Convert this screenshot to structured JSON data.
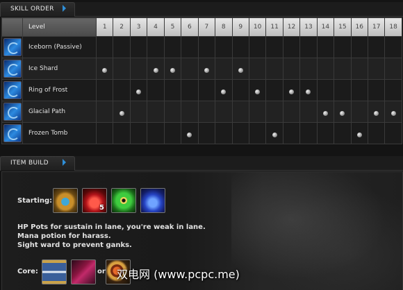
{
  "skill_section": {
    "title": "SKILL ORDER"
  },
  "skill_table": {
    "level_header": "Level",
    "levels": [
      "1",
      "2",
      "3",
      "4",
      "5",
      "6",
      "7",
      "8",
      "9",
      "10",
      "11",
      "12",
      "13",
      "14",
      "15",
      "16",
      "17",
      "18"
    ],
    "skills": [
      {
        "name": "Iceborn (Passive)",
        "icon": "iceborn-icon",
        "points": []
      },
      {
        "name": "Ice Shard",
        "icon": "ice-shard-icon",
        "points": [
          1,
          4,
          5,
          7,
          9
        ]
      },
      {
        "name": "Ring of Frost",
        "icon": "ring-of-frost-icon",
        "points": [
          3,
          8,
          10,
          12,
          13
        ]
      },
      {
        "name": "Glacial Path",
        "icon": "glacial-path-icon",
        "points": [
          2,
          14,
          15,
          17,
          18
        ]
      },
      {
        "name": "Frozen Tomb",
        "icon": "frozen-tomb-icon",
        "points": [
          6,
          11,
          16
        ]
      }
    ]
  },
  "item_section": {
    "title": "ITEM BUILD"
  },
  "item_build": {
    "starting_label": "Starting:",
    "starting_items": [
      {
        "icon": "amulet-icon",
        "count": ""
      },
      {
        "icon": "health-potion-icon",
        "count": "5"
      },
      {
        "icon": "sight-ward-icon",
        "count": ""
      },
      {
        "icon": "mana-potion-icon",
        "count": ""
      }
    ],
    "notes": [
      "HP Pots for sustain in lane, you're weak in lane.",
      "Mana potion for harass.",
      "Sight ward to prevent ganks."
    ],
    "core_label": "Core:",
    "core_items": [
      {
        "icon": "hourglass-icon"
      },
      {
        "icon": "spellbook-icon"
      },
      {
        "icon": "ring-icon"
      }
    ],
    "or_text": "or"
  },
  "watermark": "双电网 (www.pcpc.me)"
}
